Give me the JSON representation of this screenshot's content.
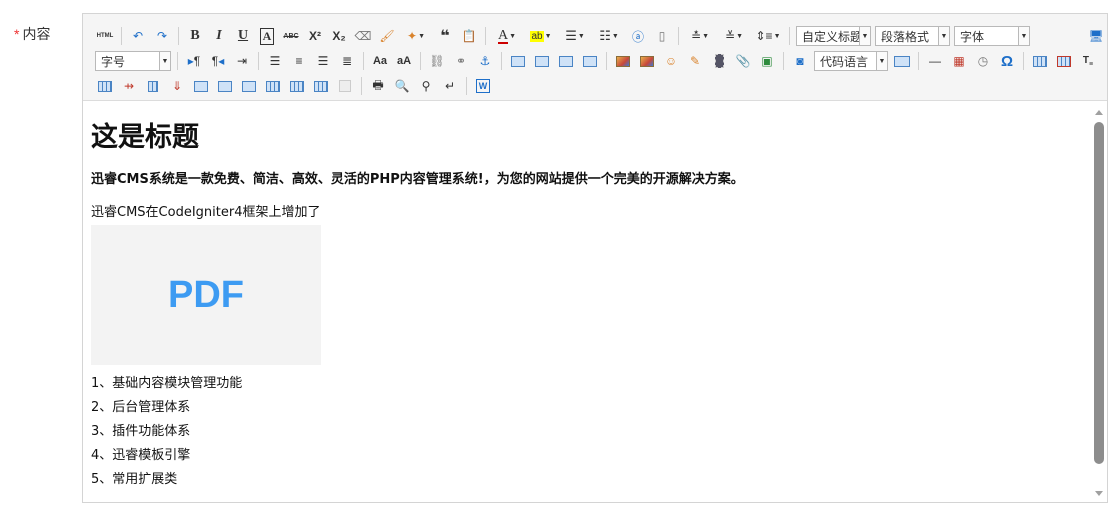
{
  "field": {
    "required_mark": "*",
    "label": "内容"
  },
  "toolbar": {
    "html_btn": "HTML",
    "bold": "B",
    "italic": "I",
    "underline": "U",
    "strike": "ABC",
    "sup": "X²",
    "sub": "X₂",
    "font_color": "A",
    "paragraph": "¶",
    "custom_title": "自定义标题",
    "paragraph_format": "段落格式",
    "font_family": "字体",
    "font_size": "字号",
    "code_language": "代码语言",
    "omega": "Ω",
    "word": "W"
  },
  "content": {
    "heading": "这是标题",
    "lead": "迅睿CMS系统是一款免费、简洁、高效、灵活的PHP内容管理系统!，为您的网站提供一个完美的开源解决方案。",
    "paragraph": "迅睿CMS在CodeIgniter4框架上增加了",
    "image_text": "PDF",
    "list": [
      "1、基础内容模块管理功能",
      "2、后台管理体系",
      "3、插件功能体系",
      "4、迅睿模板引擎",
      "5、常用扩展类"
    ]
  },
  "colors": {
    "accent": "#1e6fc9",
    "pdf_text": "#3d9bf2",
    "required": "#e33333"
  },
  "icons": [
    "source-html-icon",
    "undo-icon",
    "redo-icon",
    "bold-icon",
    "italic-icon",
    "underline-icon",
    "fontborder-icon",
    "strikethrough-icon",
    "superscript-icon",
    "subscript-icon",
    "eraser-icon",
    "format-brush-icon",
    "autotypeset-icon",
    "blockquote-icon",
    "paste-plain-icon",
    "font-color-icon",
    "background-color-icon",
    "ordered-list-icon",
    "unordered-list-icon",
    "select-all-icon",
    "clear-doc-icon",
    "rowspacing-top-icon",
    "rowspacing-bottom-icon",
    "lineheight-icon",
    "ltr-icon",
    "rtl-icon",
    "indent-icon",
    "align-left-icon",
    "align-center-icon",
    "align-right-icon",
    "align-justify-icon",
    "uppercase-icon",
    "lowercase-icon",
    "link-icon",
    "unlink-icon",
    "anchor-icon",
    "image-none-icon",
    "image-left-icon",
    "image-right-icon",
    "image-center-icon",
    "simple-upload-icon",
    "insert-image-icon",
    "emotion-icon",
    "scrawl-icon",
    "insert-video-icon",
    "attachment-icon",
    "map-icon",
    "insert-frame-icon",
    "insert-code-icon",
    "page-break-icon",
    "horizontal-icon",
    "date-icon",
    "time-icon",
    "special-char-icon",
    "insert-table-icon",
    "delete-table-icon",
    "insert-paragraph-before-table-icon",
    "insert-row-icon",
    "delete-row-icon",
    "insert-col-icon",
    "delete-col-icon",
    "merge-cells-icon",
    "merge-right-icon",
    "merge-down-icon",
    "split-cells-icon",
    "split-rows-icon",
    "split-cols-icon",
    "charts-icon",
    "print-icon",
    "preview-icon",
    "search-replace-icon",
    "line-break-icon",
    "word-import-icon"
  ]
}
